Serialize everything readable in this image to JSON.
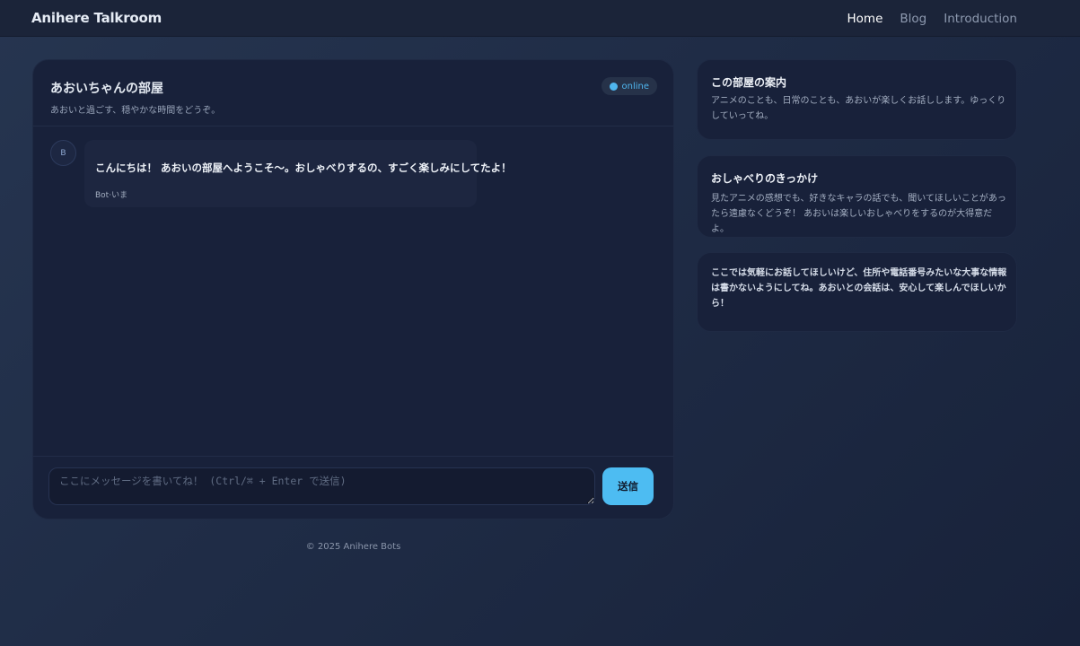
{
  "app": {
    "brand": "Anihere Talkroom",
    "nav": [
      {
        "label": "Home",
        "active": true
      },
      {
        "label": "Blog",
        "active": false
      },
      {
        "label": "Introduction",
        "active": false
      }
    ]
  },
  "chat": {
    "title": "あおいちゃんの部屋",
    "subtitle": "あおいと過ごす、穏やかな時間をどうぞ。",
    "status": "online",
    "messages": [
      {
        "avatar": "B",
        "text": "こんにちは！ あおいの部屋へようこそ〜。おしゃべりするの、すごく楽しみにしてたよ！",
        "meta": "Bot·いま"
      }
    ],
    "input_placeholder": "ここにメッセージを書いてね！ (Ctrl/⌘ + Enter で送信)",
    "send_label": "送信"
  },
  "sidebar": {
    "cards": [
      {
        "title": "この部屋の案内",
        "body": "アニメのことも、日常のことも、あおいが楽しくお話しします。ゆっくりしていってね。"
      },
      {
        "title": "おしゃべりのきっかけ",
        "body": "見たアニメの感想でも、好きなキャラの話でも、聞いてほしいことがあったら遠慮なくどうぞ！ あおいは楽しいおしゃべりをするのが大得意だよ。"
      },
      {
        "body": "ここでは気軽にお話してほしいけど、住所や電話番号みたいな大事な情報は書かないようにしてね。あおいとの会話は、安心して楽しんでほしいから！"
      }
    ]
  },
  "footer": {
    "text": "© 2025 Anihere Bots"
  },
  "colors": {
    "accent": "#4dbcf2",
    "background": "#1f2c46",
    "card": "#18213a"
  }
}
